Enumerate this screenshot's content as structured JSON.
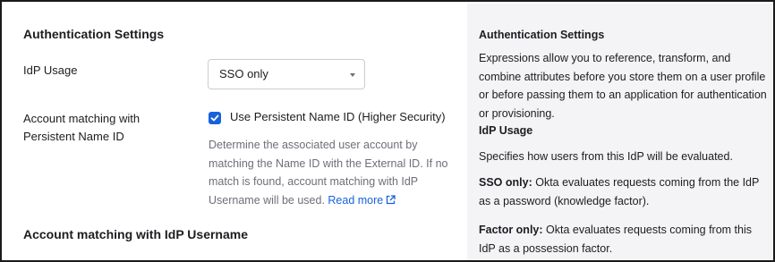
{
  "form": {
    "section_title": "Authentication Settings",
    "idp_usage_label": "IdP Usage",
    "idp_usage_value": "SSO only",
    "account_matching_label": "Account matching with Persistent Name ID",
    "persistent_checkbox_label": "Use Persistent Name ID (Higher Security)",
    "persistent_checked": true,
    "help_text": "Determine the associated user account by matching the Name ID with the External ID. If no match is found, account matching with IdP Username will be used.",
    "read_more": "Read more",
    "section_title_2": "Account matching with IdP Username"
  },
  "help_panel": {
    "title": "Authentication Settings",
    "intro": "Expressions allow you to reference, transform, and combine attributes before you store them on a user profile or before passing them to an application for authentication or provisioning.",
    "idp_usage_heading": "IdP Usage",
    "idp_usage_desc": "Specifies how users from this IdP will be evaluated.",
    "sso_only_term": "SSO only:",
    "sso_only_desc": "Okta evaluates requests coming from the IdP as a password (knowledge factor).",
    "factor_only_term": "Factor only:",
    "factor_only_desc": "Okta evaluates requests coming from this IdP as a possession factor."
  },
  "colors": {
    "accent": "#1662dd",
    "muted_text": "#6e6e78",
    "panel_bg": "#f4f4f6"
  }
}
